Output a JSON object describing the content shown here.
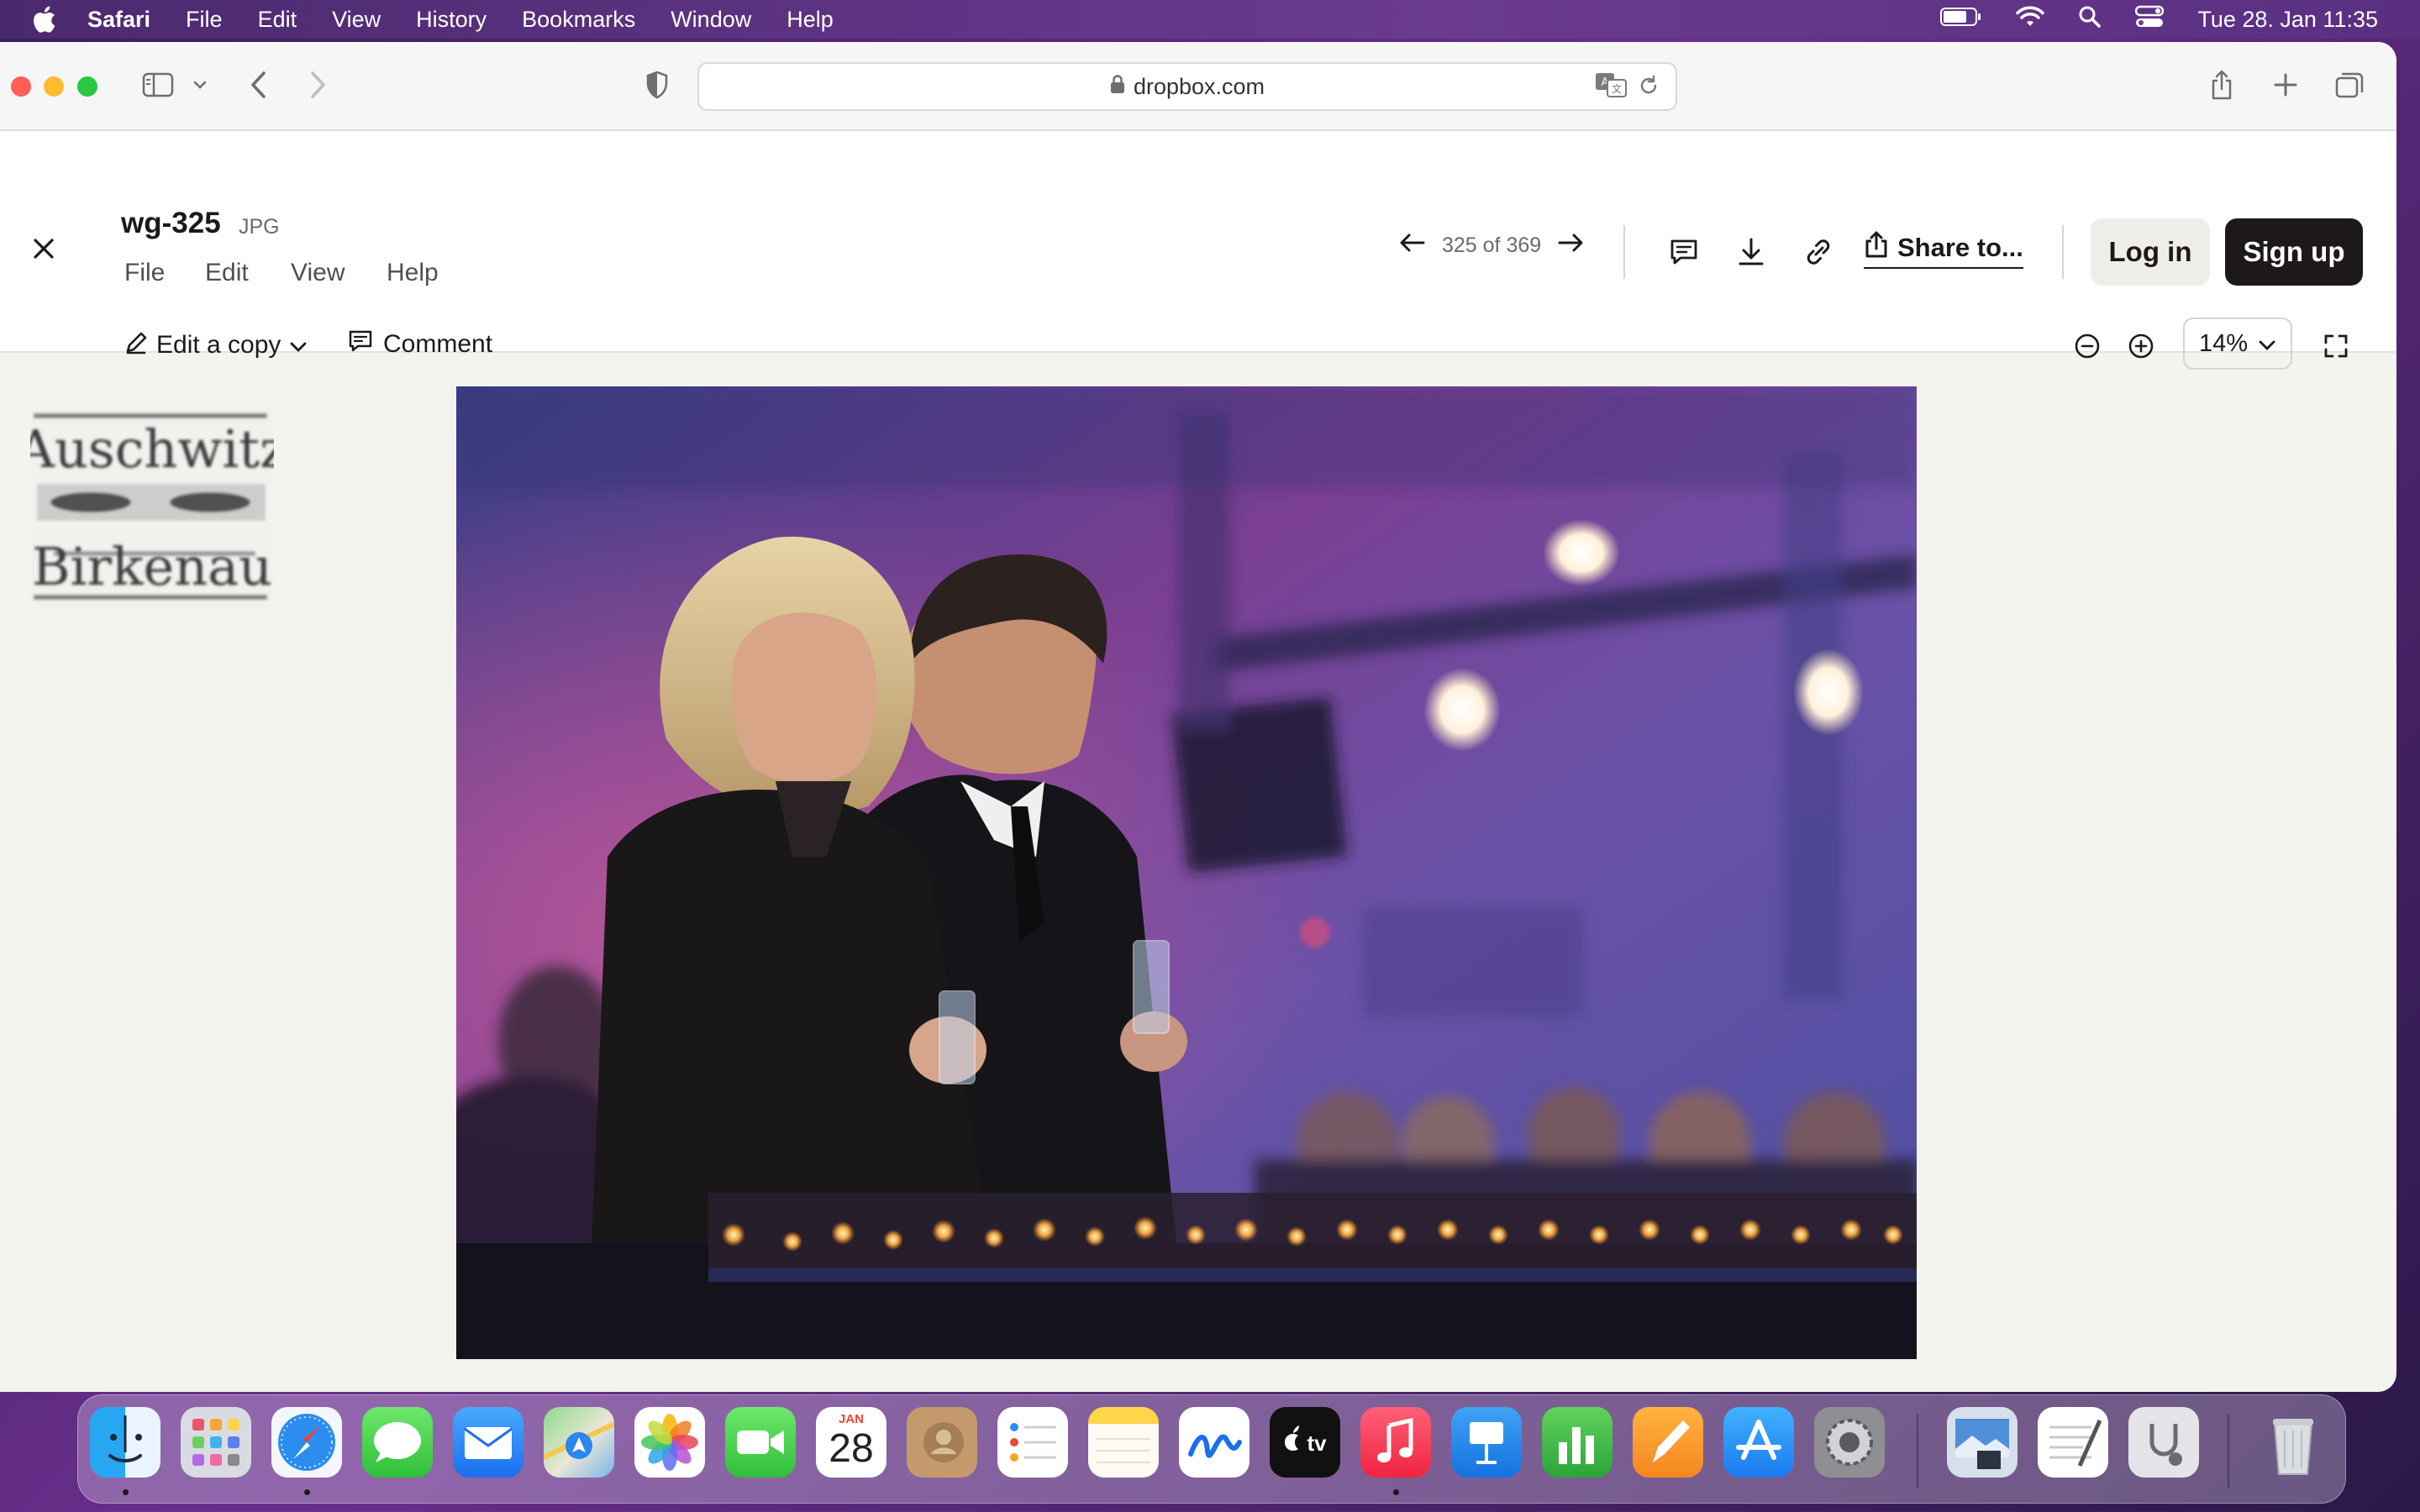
{
  "menubar": {
    "app_name": "Safari",
    "items": [
      "File",
      "Edit",
      "View",
      "History",
      "Bookmarks",
      "Window",
      "Help"
    ],
    "clock": "Tue 28. Jan  11:35",
    "status_icons": [
      "battery-icon",
      "wifi-icon",
      "spotlight-search-icon",
      "control-center-icon"
    ]
  },
  "browser": {
    "url": "dropbox.com",
    "toolbar_icons": [
      "sidebar-toggle-icon",
      "chevron-down-icon",
      "back-icon",
      "forward-icon",
      "privacy-shield-icon",
      "share-icon",
      "new-tab-icon",
      "tab-overview-icon"
    ]
  },
  "viewer": {
    "file_name": "wg-325",
    "file_type": "JPG",
    "menu": [
      "File",
      "Edit",
      "View",
      "Help"
    ],
    "position": "325 of 369",
    "share_label": "Share to...",
    "login_label": "Log in",
    "signup_label": "Sign up",
    "edit_copy_label": "Edit a copy",
    "comment_label": "Comment",
    "zoom": "14%"
  },
  "thumbnail": {
    "lines": [
      "Auschwitz",
      "Birkenau"
    ]
  },
  "dock": {
    "apps": [
      "Finder",
      "Launchpad",
      "Safari",
      "Messages",
      "Mail",
      "Maps",
      "Photos",
      "FaceTime",
      "Calendar",
      "Contacts",
      "Reminders",
      "Notes",
      "Freeform",
      "TV",
      "Music",
      "Keynote",
      "Numbers",
      "Pages",
      "App Store",
      "System Settings",
      "Preview",
      "TextEdit",
      "Disk Utility",
      "Trash"
    ],
    "calendar_month": "JAN",
    "calendar_day": "28",
    "tv_label": "tv"
  },
  "colors": {
    "accent_dark": "#1e1919",
    "window_bg": "#f4f3f0",
    "signup_bg": "#1e1919"
  }
}
